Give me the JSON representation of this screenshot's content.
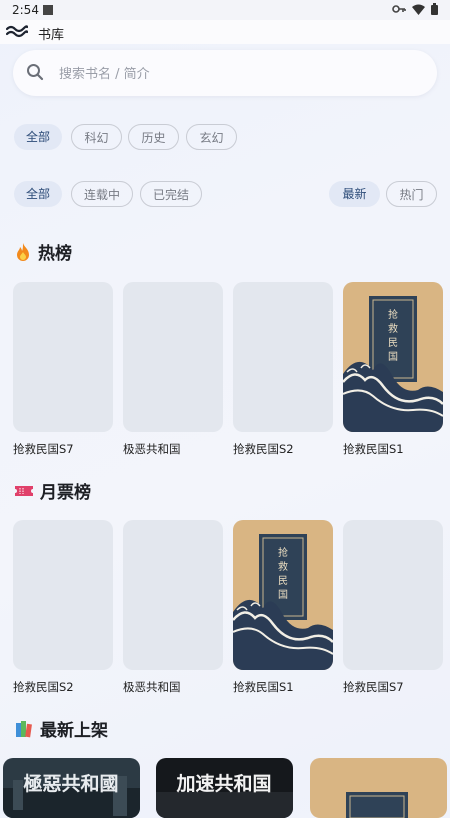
{
  "status": {
    "time": "2:54"
  },
  "app": {
    "title": "书库"
  },
  "search": {
    "placeholder": "搜索书名 / 简介"
  },
  "genres": [
    "全部",
    "科幻",
    "历史",
    "玄幻"
  ],
  "statusFilters": [
    "全部",
    "连载中",
    "已完结"
  ],
  "sorts": [
    "最新",
    "热门"
  ],
  "sections": {
    "hot": {
      "icon": "fire-icon",
      "title": "热榜",
      "books": [
        "抢救民国S7",
        "极恶共和国",
        "抢救民国S2",
        "抢救民国S1"
      ]
    },
    "monthly": {
      "icon": "ticket-icon",
      "title": "月票榜",
      "books": [
        "抢救民国S2",
        "极恶共和国",
        "抢救民国S1",
        "抢救民国S7"
      ]
    },
    "latest": {
      "icon": "books-icon",
      "title": "最新上架",
      "covers": [
        "極惡共和國",
        "加速共和国"
      ]
    }
  },
  "coverText": "抢救民国",
  "colors": {
    "accent": "#2c4b78",
    "chipActiveBg": "#e2e8f5",
    "placeholderCover": "#e3e7ee",
    "coverTan": "#d9b583",
    "coverNavy": "#2f4257"
  }
}
